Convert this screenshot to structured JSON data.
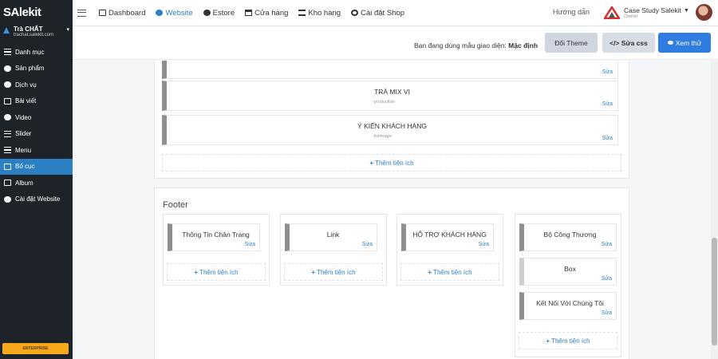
{
  "brand": {
    "logo_text": "SAlekit"
  },
  "shop": {
    "name": "Trà CHẤT",
    "domain": "trachat.salekit.com"
  },
  "sidebar": {
    "items": [
      {
        "label": "Danh mục",
        "icon": "list-icon"
      },
      {
        "label": "Sản phẩm",
        "icon": "product-icon"
      },
      {
        "label": "Dịch vụ",
        "icon": "service-icon"
      },
      {
        "label": "Bài viết",
        "icon": "article-icon"
      },
      {
        "label": "Video",
        "icon": "video-icon"
      },
      {
        "label": "Slider",
        "icon": "slider-icon"
      },
      {
        "label": "Menu",
        "icon": "menu-icon"
      },
      {
        "label": "Bố cục",
        "icon": "layout-icon",
        "active": true
      },
      {
        "label": "Album",
        "icon": "album-icon"
      },
      {
        "label": "Cài đặt Website",
        "icon": "gear-icon"
      }
    ],
    "plan_badge": "ENTERPRISE"
  },
  "topnav": {
    "items": [
      {
        "label": "Dashboard",
        "icon": "monitor-icon"
      },
      {
        "label": "Website",
        "icon": "globe-icon",
        "active": true
      },
      {
        "label": "Estore",
        "icon": "estore-icon"
      },
      {
        "label": "Cửa hàng",
        "icon": "store-icon"
      },
      {
        "label": "Kho hàng",
        "icon": "warehouse-icon"
      },
      {
        "label": "Cài đặt Shop",
        "icon": "gear-icon"
      }
    ],
    "help": "Hướng dẫn",
    "account_name": "Case Study Salekit",
    "account_role": "Owner"
  },
  "themebar": {
    "text": "Bạn đang dùng mẫu giao diện:",
    "theme_name": "Mặc định",
    "change_theme": "Đổi Theme",
    "edit_css": "Sửa css",
    "preview": "Xem thử"
  },
  "content": {
    "edit_label": "Sửa",
    "add_widget": "Thêm tiện ích",
    "widgets": [
      {
        "title": "",
        "type": "-phone-"
      },
      {
        "title": "TRÀ MIX VỊ",
        "type": "-productlist-"
      },
      {
        "title": "Ý KIẾN KHÁCH HÀNG",
        "type": "-listimage-"
      }
    ],
    "footer": {
      "title": "Footer",
      "columns": [
        {
          "widgets": [
            "Thông Tin Chân Trang"
          ]
        },
        {
          "widgets": [
            "Link"
          ]
        },
        {
          "widgets": [
            "HỖ TRỢ KHÁCH HÀNG"
          ]
        },
        {
          "widgets": [
            "Bộ Công Thương",
            "Box",
            "Kết Nối Với Chúng Tôi"
          ]
        }
      ]
    }
  },
  "colors": {
    "accent": "#2c7fc2",
    "sidebar_bg": "#1d2329",
    "preview_btn": "#2f7de1",
    "badge": "#f7a81b"
  }
}
